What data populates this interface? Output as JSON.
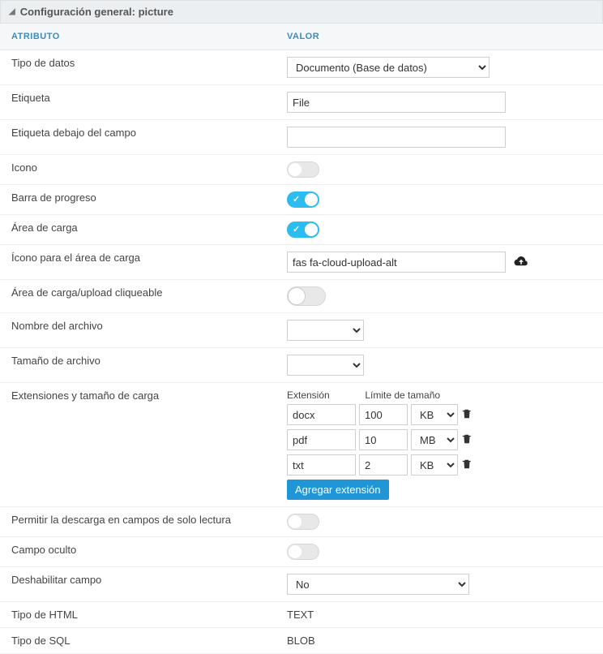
{
  "header": {
    "title": "Configuración general: picture"
  },
  "columns": {
    "attr": "ATRIBUTO",
    "val": "VALOR"
  },
  "rows": {
    "dtype": {
      "label": "Tipo de datos",
      "value": "Documento (Base de datos)"
    },
    "etiq": {
      "label": "Etiqueta",
      "value": "File"
    },
    "etiq2": {
      "label": "Etiqueta debajo del campo",
      "value": ""
    },
    "icono": {
      "label": "Icono"
    },
    "barra": {
      "label": "Barra de progreso"
    },
    "area": {
      "label": "Área de carga"
    },
    "iconarea": {
      "label": "Ícono para el área de carga",
      "value": "fas fa-cloud-upload-alt"
    },
    "click": {
      "label": "Área de carga/upload cliqueable"
    },
    "nombre": {
      "label": "Nombre del archivo"
    },
    "tam": {
      "label": "Tamaño de archivo"
    },
    "ext": {
      "label": "Extensiones y tamaño de carga",
      "hdr_ext": "Extensión",
      "hdr_lim": "Límite de tamaño",
      "rows": [
        {
          "ext": "docx",
          "lim": "100",
          "unit": "KB"
        },
        {
          "ext": "pdf",
          "lim": "10",
          "unit": "MB"
        },
        {
          "ext": "txt",
          "lim": "2",
          "unit": "KB"
        }
      ],
      "add_btn": "Agregar extensión"
    },
    "descarga": {
      "label": "Permitir la descarga en campos de solo lectura"
    },
    "oculto": {
      "label": "Campo oculto"
    },
    "deshab": {
      "label": "Deshabilitar campo",
      "value": "No"
    },
    "html": {
      "label": "Tipo de HTML",
      "value": "TEXT"
    },
    "sql": {
      "label": "Tipo de SQL",
      "value": "BLOB"
    }
  }
}
